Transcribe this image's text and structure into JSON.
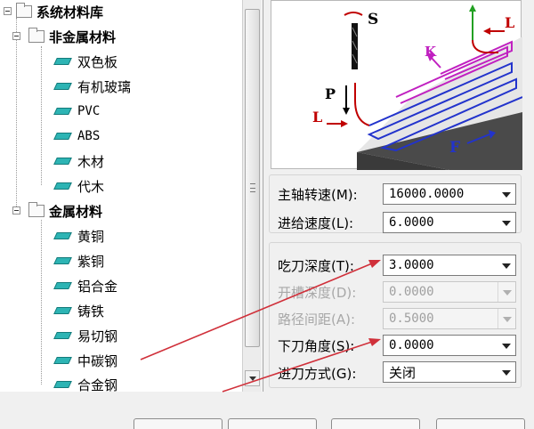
{
  "tree": {
    "root_label": "系统材料库",
    "groups": [
      {
        "label": "非金属材料",
        "items": [
          "双色板",
          "有机玻璃",
          "PVC",
          "ABS",
          "木材",
          "代木"
        ]
      },
      {
        "label": "金属材料",
        "items": [
          "黄铜",
          "紫铜",
          "铝合金",
          "铸铁",
          "易切钢",
          "中碳钢",
          "合金钢"
        ]
      }
    ]
  },
  "diagram": {
    "label_s": "S",
    "label_l_top": "L",
    "label_k": "K",
    "label_p": "P",
    "label_l_left": "L",
    "label_f": "F"
  },
  "form": {
    "spindle": {
      "label": "主轴转速(M):",
      "value": "16000.0000"
    },
    "feed": {
      "label": "进给速度(L):",
      "value": "6.0000"
    },
    "cut_depth": {
      "label": "吃刀深度(T):",
      "value": "3.0000"
    },
    "slot_depth": {
      "label": "开槽深度(D):",
      "value": "0.0000"
    },
    "path_spacing": {
      "label": "路径间距(A):",
      "value": "0.5000"
    },
    "plunge_angle": {
      "label": "下刀角度(S):",
      "value": "0.0000"
    },
    "entry_mode": {
      "label": "进刀方式(G):",
      "value": "关闭"
    }
  },
  "colors": {
    "leaf_icon": "#2db4b4",
    "annotation_arrow": "#d0303a",
    "path_blue": "#2233cc",
    "path_magenta": "#c020c0"
  }
}
